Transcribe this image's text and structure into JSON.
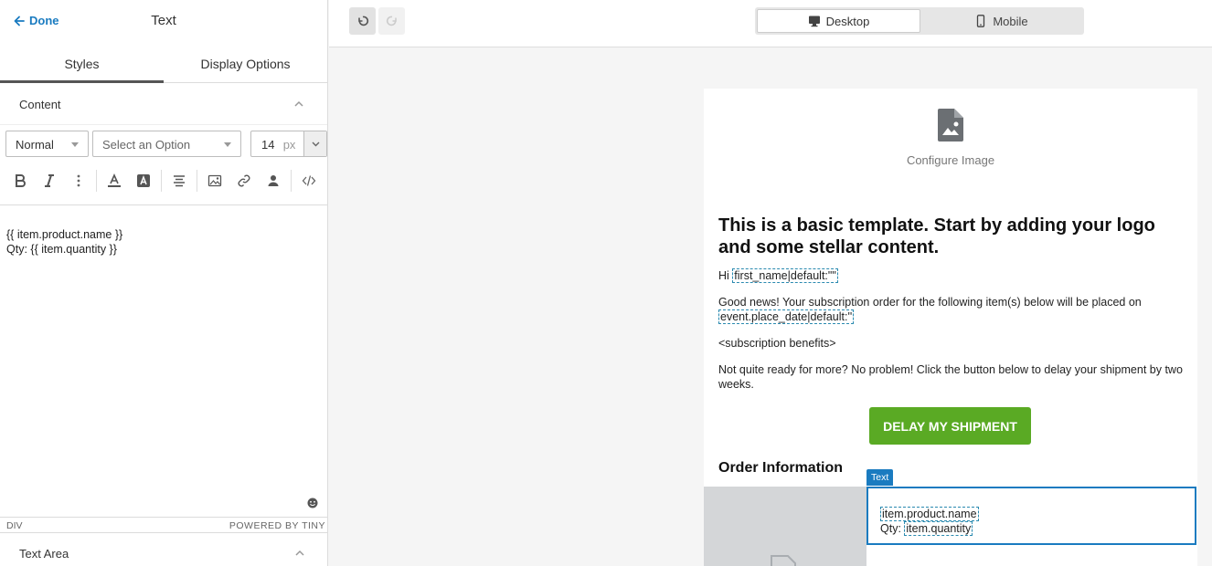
{
  "panel": {
    "done_label": "Done",
    "title": "Text",
    "tabs": [
      {
        "label": "Styles",
        "active": true
      },
      {
        "label": "Display Options",
        "active": false
      }
    ],
    "content_section_label": "Content",
    "text_area_section_label": "Text Area"
  },
  "format": {
    "block_style": "Normal",
    "font_placeholder": "Select an Option",
    "font_size": "14",
    "font_size_unit": "px"
  },
  "toolbar_icons": [
    "bold-icon",
    "italic-icon",
    "more-icon",
    "text-color-icon",
    "background-color-icon",
    "align-center-icon",
    "image-icon",
    "link-icon",
    "person-icon",
    "code-icon"
  ],
  "editor": {
    "lines": [
      "{{ item.product.name }}",
      "Qty: {{ item.quantity }}"
    ],
    "status_path": "DIV",
    "powered_by": "POWERED BY TINY"
  },
  "topbar": {
    "desktop_label": "Desktop",
    "mobile_label": "Mobile",
    "active_device": "Desktop"
  },
  "email": {
    "image_caption": "Configure Image",
    "heading": "This is a basic template. Start by adding your logo and some stellar content.",
    "greeting_prefix": "Hi ",
    "greeting_tag": "first_name|default:\"\"",
    "news_text": "Good news! Your subscription order for the following item(s) below will be placed on",
    "news_tag": "event.place_date|default:''",
    "benefits": "<subscription benefits>",
    "delay_text": "Not quite ready for more? No problem! Click the button below to delay your shipment by two weeks.",
    "cta_label": "DELAY MY SHIPMENT",
    "order_title": "Order Information",
    "text_block_label": "Text",
    "item_name_tag": "item.product.name",
    "qty_prefix": "Qty: ",
    "qty_tag": "item.quantity"
  },
  "colors": {
    "accent": "#1a7bc0",
    "cta": "#5aaa24"
  }
}
